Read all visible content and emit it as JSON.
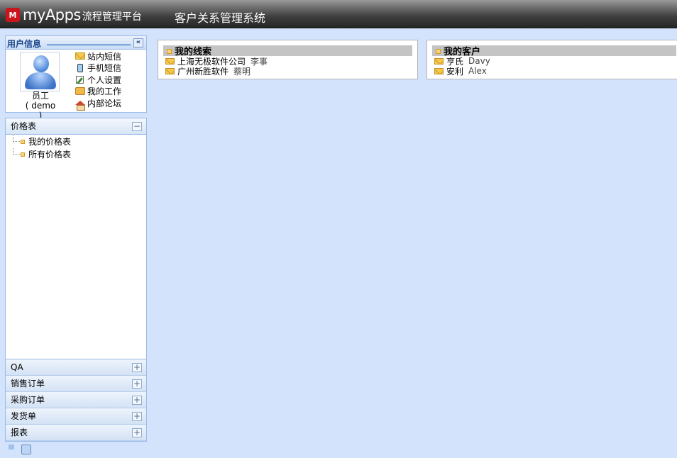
{
  "header": {
    "logo_text": "myApps",
    "logo_sub": "流程管理平台",
    "app_title": "客户关系管理系统"
  },
  "user_panel": {
    "title": "用户信息",
    "collapse_label": "«",
    "user_name": "员工",
    "user_id": "( demo )",
    "links": [
      {
        "label": "站内短信",
        "icon": "envelope-icon"
      },
      {
        "label": "手机短信",
        "icon": "mobile-phone-icon"
      },
      {
        "label": "个人设置",
        "icon": "edit-icon"
      },
      {
        "label": "我的工作",
        "icon": "work-icon"
      },
      {
        "label": "内部论坛",
        "icon": "home-icon"
      }
    ]
  },
  "nav": {
    "expanded": {
      "label": "价格表",
      "toggle": "−",
      "items": [
        "我的价格表",
        "所有价格表"
      ]
    },
    "collapsed": [
      {
        "label": "QA",
        "toggle": "+"
      },
      {
        "label": "销售订单",
        "toggle": "+"
      },
      {
        "label": "采购订单",
        "toggle": "+"
      },
      {
        "label": "发货单",
        "toggle": "+"
      },
      {
        "label": "报表",
        "toggle": "+"
      }
    ]
  },
  "portlets": {
    "leads": {
      "title": "我的线索",
      "rows": [
        {
          "company": "上海无极软件公司",
          "contact": "李事"
        },
        {
          "company": "广州新胜软件",
          "contact": "蔡明"
        }
      ]
    },
    "customers": {
      "title": "我的客户",
      "rows": [
        {
          "company": "亨氏",
          "contact": "Davy"
        },
        {
          "company": "安利",
          "contact": "Alex"
        }
      ]
    }
  }
}
